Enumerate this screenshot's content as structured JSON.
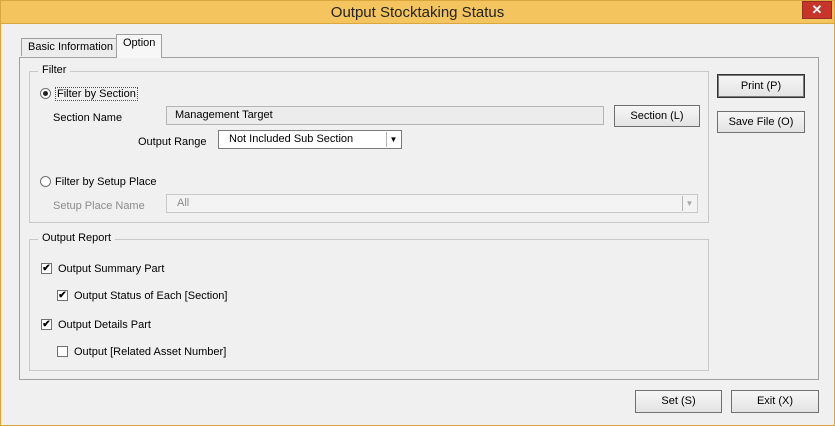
{
  "window": {
    "title": "Output Stocktaking Status",
    "close_icon": "✕"
  },
  "tabs": [
    {
      "label": "Basic Information"
    },
    {
      "label": "Option"
    }
  ],
  "filter": {
    "group_label": "Filter",
    "by_section": {
      "label": "Filter by Section",
      "selected": true,
      "section_name_label": "Section Name",
      "section_name_value": "Management Target",
      "section_button": "Section (L)",
      "output_range_label": "Output Range",
      "output_range_value": "Not Included Sub Section"
    },
    "by_setup_place": {
      "label": "Filter by Setup Place",
      "selected": false,
      "setup_place_label": "Setup Place Name",
      "setup_place_value": "All"
    }
  },
  "output_report": {
    "group_label": "Output Report",
    "items": [
      {
        "label": "Output Summary Part",
        "checked": true
      },
      {
        "label": "Output Status of Each [Section]",
        "checked": true
      },
      {
        "label": "Output Details Part",
        "checked": true
      },
      {
        "label": "Output [Related Asset Number]",
        "checked": false
      }
    ],
    "check_mark": "✔"
  },
  "side_buttons": {
    "print": "Print (P)",
    "save_file": "Save File (O)"
  },
  "footer_buttons": {
    "set": "Set (S)",
    "exit": "Exit (X)"
  },
  "dropdown_arrow": "▼",
  "colors": {
    "titlebar": "#f4c45e",
    "close": "#c7342a"
  }
}
